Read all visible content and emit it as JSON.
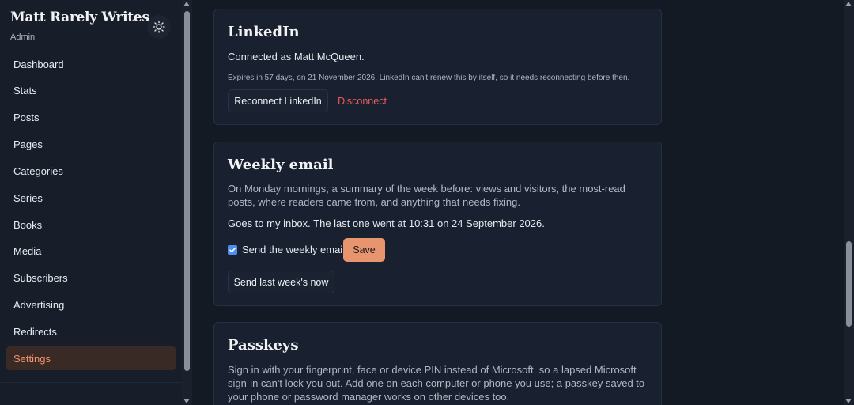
{
  "brand": {
    "title": "Matt Rarely Writes",
    "subtitle": "Admin"
  },
  "nav": [
    {
      "label": "Dashboard",
      "active": false
    },
    {
      "label": "Stats",
      "active": false
    },
    {
      "label": "Posts",
      "active": false
    },
    {
      "label": "Pages",
      "active": false
    },
    {
      "label": "Categories",
      "active": false
    },
    {
      "label": "Series",
      "active": false
    },
    {
      "label": "Books",
      "active": false
    },
    {
      "label": "Media",
      "active": false
    },
    {
      "label": "Subscribers",
      "active": false
    },
    {
      "label": "Advertising",
      "active": false
    },
    {
      "label": "Redirects",
      "active": false
    },
    {
      "label": "Settings",
      "active": true
    }
  ],
  "linkedin": {
    "title": "LinkedIn",
    "connected_prefix": "Connected as ",
    "connected_name": "Matt McQueen",
    "connected_suffix": ".",
    "expires": "Expires in 57 days, on 21 November 2026. LinkedIn can't renew this by itself, so it needs reconnecting before then.",
    "reconnect_label": "Reconnect LinkedIn",
    "disconnect_label": "Disconnect"
  },
  "weekly": {
    "title": "Weekly email",
    "description": "On Monday mornings, a summary of the week before: views and visitors, the most-read posts, where readers came from, and anything that needs fixing.",
    "goes_prefix": "Goes to ",
    "goes_target": "my inbox",
    "goes_suffix": ". The last one went at 10:31 on 24 September 2026.",
    "checkbox_label": "Send the weekly email",
    "checkbox_checked": true,
    "save_label": "Save",
    "send_now_label": "Send last week's now"
  },
  "passkeys": {
    "title": "Passkeys",
    "description": "Sign in with your fingerprint, face or device PIN instead of Microsoft, so a lapsed Microsoft sign-in can't lock you out. Add one on each computer or phone you use; a passkey saved to your phone or password manager works on other devices too."
  },
  "colors": {
    "accent": "#e8956f",
    "danger": "#ef5a5a",
    "checkbox": "#4d8ef2"
  }
}
